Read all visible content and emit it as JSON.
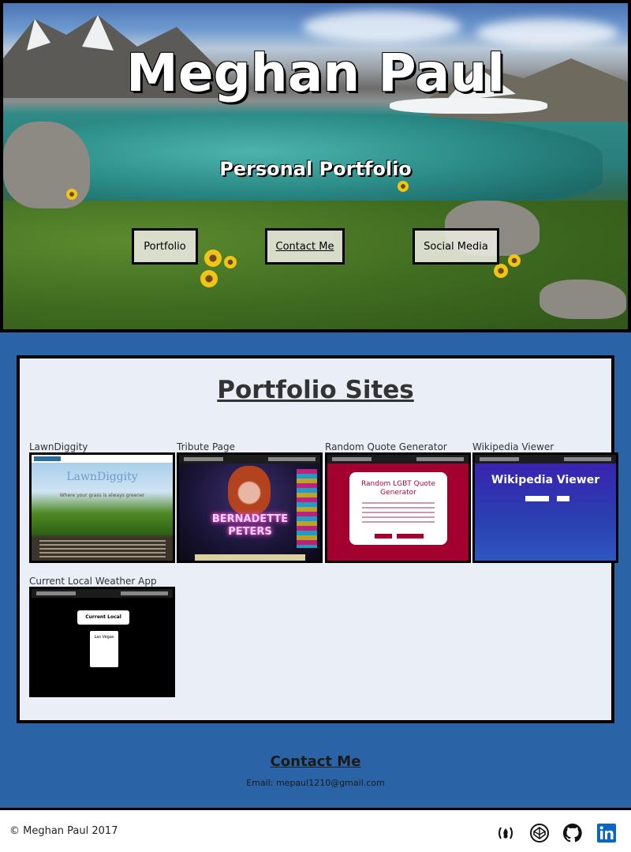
{
  "hero": {
    "title": "Meghan Paul",
    "subtitle": "Personal Portfolio",
    "buttons": [
      {
        "label": "Portfolio"
      },
      {
        "label": "Contact Me"
      },
      {
        "label": "Social Media"
      }
    ]
  },
  "portfolio": {
    "heading": "Portfolio Sites",
    "projects": [
      {
        "label": "LawnDiggity",
        "thumb_title": "LawnDiggity",
        "thumb_tagline": "Where your grass is always greener"
      },
      {
        "label": "Tribute Page",
        "thumb_title": "BERNADETTE PETERS"
      },
      {
        "label": "Random Quote Generator",
        "thumb_title": "Random LGBT Quote Generator"
      },
      {
        "label": "Wikipedia Viewer",
        "thumb_title": "Wikipedia Viewer"
      },
      {
        "label": "Current Local Weather App",
        "thumb_title": "Current Local Weather",
        "thumb_city": "Las Vegas"
      }
    ]
  },
  "contact": {
    "heading": "Contact Me",
    "email": "Email: mepaul1210@gmail.com"
  },
  "footer": {
    "copyright": "© Meghan Paul 2017",
    "icons": [
      "freecodecamp-icon",
      "codepen-icon",
      "github-icon",
      "linkedin-icon"
    ]
  },
  "colors": {
    "section_blue": "#2b64a6",
    "card_bg": "#eaeff7",
    "linkedin_blue": "#0a66c2"
  }
}
